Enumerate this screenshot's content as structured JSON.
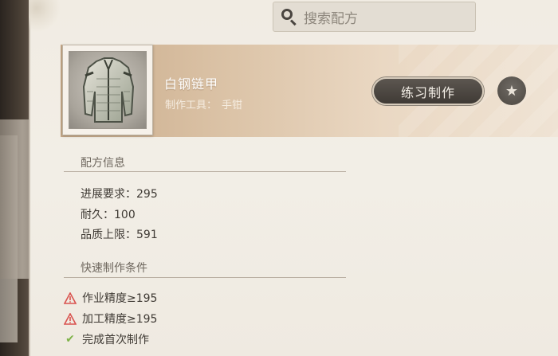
{
  "search": {
    "placeholder": "搜索配方"
  },
  "recipe": {
    "item_name": "白钢链甲",
    "tool_label": "制作工具：",
    "tool_value": "手钳",
    "practice_button": "练习制作",
    "favorite_icon": "star-icon"
  },
  "recipe_info": {
    "title": "配方信息",
    "stats": [
      {
        "label": "进展要求：",
        "value": "295"
      },
      {
        "label": "耐久：",
        "value": "100"
      },
      {
        "label": "品质上限：",
        "value": "591"
      }
    ]
  },
  "quick_craft": {
    "title": "快速制作条件",
    "conditions": [
      {
        "text": "作业精度≥195",
        "status": "unmet",
        "icon": "warning-icon"
      },
      {
        "text": "加工精度≥195",
        "status": "unmet",
        "icon": "warning-icon"
      },
      {
        "text": "完成首次制作",
        "status": "met",
        "icon": "check-icon"
      }
    ]
  },
  "colors": {
    "warning": "#d9534f",
    "check": "#7fb34a",
    "header_gradient_start": "#c9ab8a",
    "parchment": "#f1ece3"
  }
}
